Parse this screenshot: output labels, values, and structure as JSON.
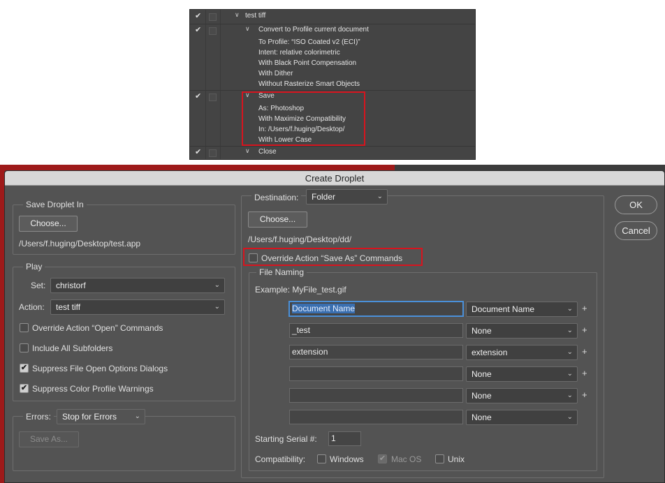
{
  "actions_panel": {
    "rows": [
      {
        "check": "✔",
        "twisty": "∨",
        "text": "test tiff"
      },
      {
        "check": "✔",
        "twisty": "∨",
        "text": "Convert to Profile current document"
      },
      {
        "text": "To Profile:  “ISO Coated v2 (ECI)”"
      },
      {
        "text": "Intent: relative colorimetric"
      },
      {
        "text": "With Black Point Compensation"
      },
      {
        "text": "With Dither"
      },
      {
        "text": "Without Rasterize Smart Objects"
      },
      {
        "check": "✔",
        "twisty": "∨",
        "text": "Save"
      },
      {
        "text": "As: Photoshop"
      },
      {
        "text": "With Maximize Compatibility"
      },
      {
        "text": "In: /Users/f.huging/Desktop/"
      },
      {
        "text": "With Lower Case"
      },
      {
        "check": "✔",
        "twisty": "∨",
        "text": "Close"
      }
    ]
  },
  "dialog": {
    "title": "Create Droplet",
    "ok_label": "OK",
    "cancel_label": "Cancel",
    "save_droplet_in": {
      "legend": "Save Droplet In",
      "choose_label": "Choose...",
      "path": "/Users/f.huging/Desktop/test.app"
    },
    "play": {
      "legend": "Play",
      "set_label": "Set:",
      "set_value": "christorf",
      "action_label": "Action:",
      "action_value": "test tiff",
      "options": [
        {
          "label": "Override Action “Open” Commands",
          "checked": false
        },
        {
          "label": "Include All Subfolders",
          "checked": false
        },
        {
          "label": "Suppress File Open Options Dialogs",
          "checked": true
        },
        {
          "label": "Suppress Color Profile Warnings",
          "checked": true
        }
      ]
    },
    "errors": {
      "label": "Errors:",
      "value": "Stop for Errors",
      "save_as_label": "Save As..."
    },
    "destination": {
      "label": "Destination:",
      "value": "Folder",
      "choose_label": "Choose...",
      "path": "/Users/f.huging/Desktop/dd/",
      "override_label": "Override Action “Save As” Commands",
      "override_checked": false
    },
    "file_naming": {
      "legend": "File Naming",
      "example": "Example: MyFile_test.gif",
      "rows": [
        {
          "field": "Document Name",
          "select": "Document Name",
          "plus": true
        },
        {
          "field": "_test",
          "select": "None",
          "plus": true
        },
        {
          "field": "extension",
          "select": "extension",
          "plus": true
        },
        {
          "field": "",
          "select": "None",
          "plus": true
        },
        {
          "field": "",
          "select": "None",
          "plus": true
        },
        {
          "field": "",
          "select": "None",
          "plus": false
        }
      ],
      "serial_label": "Starting Serial #:",
      "serial_value": "1",
      "compat_label": "Compatibility:",
      "compat": [
        {
          "label": "Windows",
          "checked": false
        },
        {
          "label": "Mac OS",
          "checked": true
        },
        {
          "label": "Unix",
          "checked": false
        }
      ]
    }
  },
  "icons": {
    "check": "✔",
    "caret": "⌄",
    "plus": "+"
  },
  "colors": {
    "highlight_red": "#d7141e",
    "dialog_bg": "#535353",
    "focus_blue": "#4a90d9"
  }
}
